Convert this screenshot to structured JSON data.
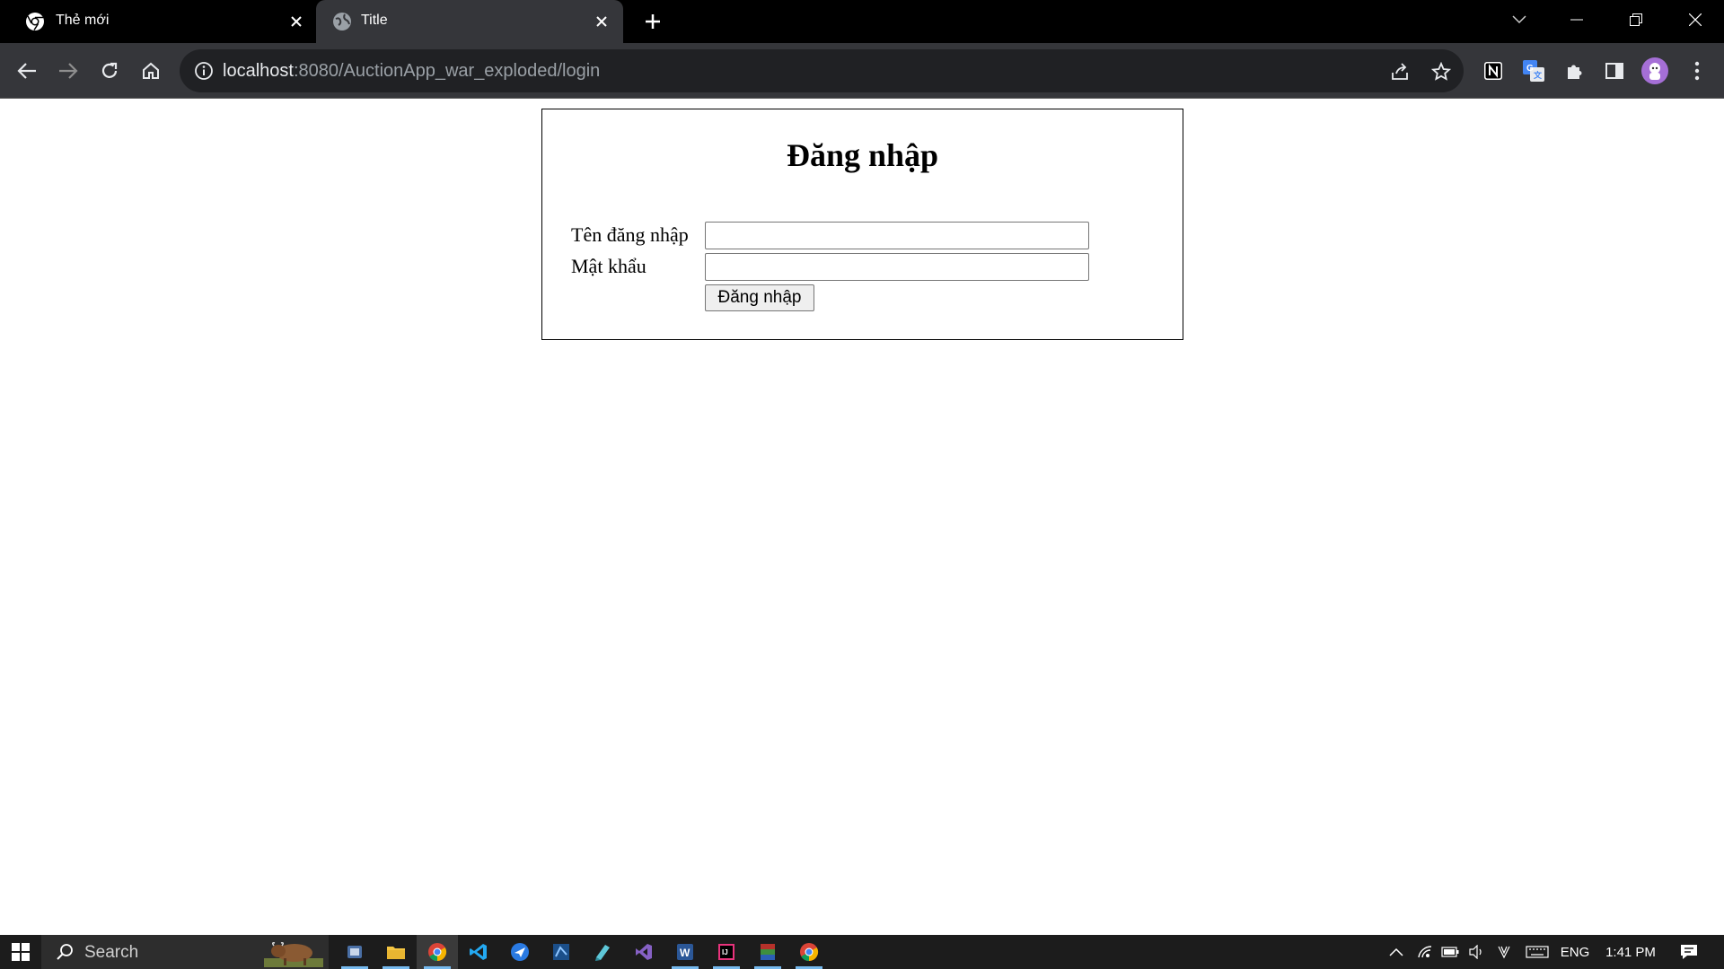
{
  "browser": {
    "tabs": [
      {
        "title": "Thẻ mới",
        "active": false
      },
      {
        "title": "Title",
        "active": true
      }
    ],
    "address": {
      "host": "localhost",
      "rest": ":8080/AuctionApp_war_exploded/login"
    }
  },
  "page": {
    "heading": "Đăng nhập",
    "username_label": "Tên đăng nhập",
    "password_label": "Mật khẩu",
    "username_value": "",
    "password_value": "",
    "submit_label": "Đăng nhập"
  },
  "taskbar": {
    "search_placeholder": "Search",
    "language": "ENG",
    "time": "1:41 PM",
    "apps": [
      "task-view",
      "file-explorer",
      "chrome",
      "vscode",
      "thunderbird",
      "jetbrains-app",
      "notepad-app",
      "visual-studio",
      "word",
      "intellij",
      "winrar",
      "chrome-alt"
    ]
  },
  "colors": {
    "tab_bar": "#000000",
    "toolbar": "#35363a",
    "omnibox": "#202124",
    "taskbar": "#1c1c1c",
    "accent": "#76b9ed"
  }
}
